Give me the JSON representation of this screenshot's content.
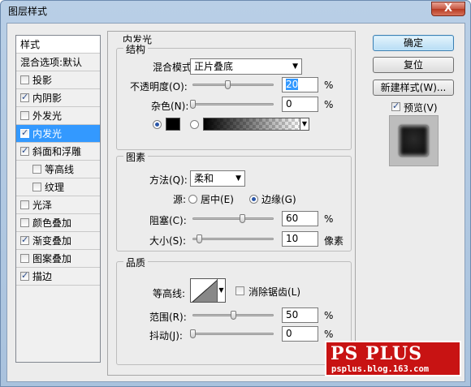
{
  "window": {
    "title": "图层样式",
    "close_glyph": "X"
  },
  "styles_list": {
    "header": "样式",
    "blend_default": "混合选项:默认",
    "items": [
      {
        "label": "投影",
        "checked": false
      },
      {
        "label": "内阴影",
        "checked": true
      },
      {
        "label": "外发光",
        "checked": false
      },
      {
        "label": "内发光",
        "checked": true,
        "selected": true
      },
      {
        "label": "斜面和浮雕",
        "checked": true
      },
      {
        "label": "等高线",
        "checked": false,
        "sub": true
      },
      {
        "label": "纹理",
        "checked": false,
        "sub": true
      },
      {
        "label": "光泽",
        "checked": false
      },
      {
        "label": "颜色叠加",
        "checked": false
      },
      {
        "label": "渐变叠加",
        "checked": true
      },
      {
        "label": "图案叠加",
        "checked": false
      },
      {
        "label": "描边",
        "checked": true
      }
    ]
  },
  "panel": {
    "title": "内发光",
    "structure": {
      "title": "结构",
      "blend_mode_label": "混合模式:",
      "blend_mode_value": "正片叠底",
      "opacity_label": "不透明度(O):",
      "opacity_value": "20",
      "opacity_unit": "%",
      "noise_label": "杂色(N):",
      "noise_value": "0",
      "noise_unit": "%",
      "color_choice": "solid",
      "solid_color": "#000000"
    },
    "elements": {
      "title": "图素",
      "method_label": "方法(Q):",
      "method_value": "柔和",
      "source_label": "源:",
      "source_center": "居中(E)",
      "source_edge": "边缘(G)",
      "source_selected": "edge",
      "choke_label": "阻塞(C):",
      "choke_value": "60",
      "choke_unit": "%",
      "size_label": "大小(S):",
      "size_value": "10",
      "size_unit": "像素"
    },
    "quality": {
      "title": "品质",
      "contour_label": "等高线:",
      "antialias_label": "消除锯齿(L)",
      "antialias_checked": false,
      "range_label": "范围(R):",
      "range_value": "50",
      "range_unit": "%",
      "jitter_label": "抖动(J):",
      "jitter_value": "0",
      "jitter_unit": "%"
    }
  },
  "buttons": {
    "ok": "确定",
    "reset": "复位",
    "new_style": "新建样式(W)...",
    "preview_label": "预览(V)",
    "preview_checked": true
  },
  "watermark": {
    "main": "PS PLUS",
    "sub": "psplus.blog.163.com"
  }
}
